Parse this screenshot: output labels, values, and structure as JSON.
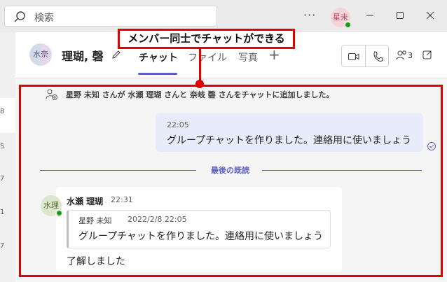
{
  "search": {
    "placeholder": "検索"
  },
  "titlebar": {
    "more": "···",
    "me_avatar": "星未"
  },
  "leftstrip": [
    "8",
    "5",
    "7",
    "1",
    "7"
  ],
  "header": {
    "group_avatar_left": "水",
    "group_avatar_right": "奈",
    "title": "理瑚, 磬",
    "tabs": [
      "チャット",
      "ファイル",
      "写真"
    ],
    "plus": "+",
    "participants_count": "3"
  },
  "annotation": {
    "label": "メンバー同士でチャットができる"
  },
  "system_message": "星野 未知 さんが 水瀬 理瑚 さんと 奈岐 磬 さんをチャットに追加しました。",
  "my_message": {
    "time": "22:05",
    "text": "グループチャットを作りました。連絡用に使いましょう"
  },
  "divider": "最後の既読",
  "peer_message": {
    "avatar": "水理",
    "sender": "水瀬 理瑚",
    "time": "22:31",
    "quote": {
      "sender": "星野 未知",
      "time": "2022/2/8 22:05",
      "text": "グループチャットを作りました。連絡用に使いましょう"
    },
    "text": "了解しました"
  },
  "colors": {
    "accent": "#5b5fc7",
    "annotation": "#e00000",
    "presence": "#13a10e"
  }
}
